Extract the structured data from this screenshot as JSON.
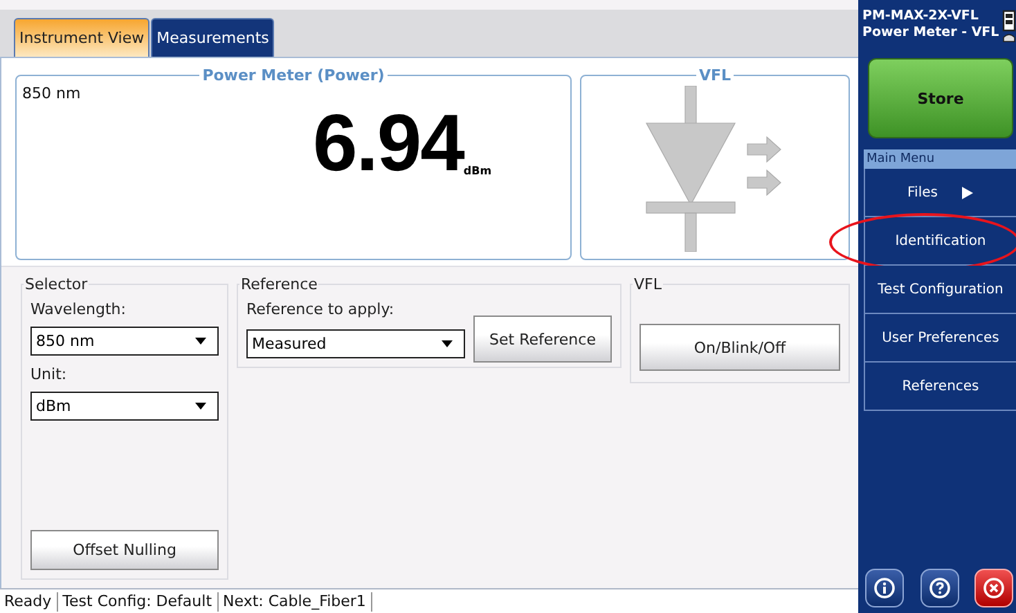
{
  "tabs": [
    {
      "label": "Instrument View",
      "selected": true
    },
    {
      "label": "Measurements",
      "selected": false
    }
  ],
  "power_meter": {
    "title": "Power Meter (Power)",
    "wavelength": "850 nm",
    "value": "6.94",
    "unit": "dBm"
  },
  "vfl_panel": {
    "title": "VFL"
  },
  "selector": {
    "title": "Selector",
    "wavelength_label": "Wavelength:",
    "wavelength_value": "850 nm",
    "unit_label": "Unit:",
    "unit_value": "dBm",
    "button": "Offset Nulling"
  },
  "reference": {
    "title": "Reference",
    "label": "Reference to apply:",
    "value": "Measured",
    "button": "Set Reference"
  },
  "vfl": {
    "title": "VFL",
    "button": "On/Blink/Off"
  },
  "status_bar": [
    "Ready",
    "Test Config: Default",
    "Next: Cable_Fiber1"
  ],
  "sidebar": {
    "device": [
      "PM-MAX-2X-VFL",
      "Power Meter - VFL"
    ],
    "store_button": "Store",
    "menu_title": "Main Menu",
    "items": [
      {
        "label": "Files",
        "kind": "submenu",
        "highlighted": false
      },
      {
        "label": "Identification",
        "kind": "action",
        "highlighted": true
      },
      {
        "label": "Test Configuration",
        "kind": "action",
        "highlighted": false
      },
      {
        "label": "User Preferences",
        "kind": "action",
        "highlighted": false
      },
      {
        "label": "References",
        "kind": "action",
        "highlighted": false
      }
    ]
  }
}
